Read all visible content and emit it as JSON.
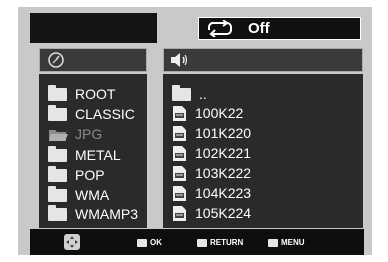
{
  "repeat": {
    "label": "Off",
    "icon": "repeat-icon"
  },
  "left_panel": {
    "header_icon": "clock-icon",
    "folders": [
      {
        "label": "ROOT",
        "icon": "folder-icon",
        "state": "normal"
      },
      {
        "label": "CLASSIC",
        "icon": "folder-icon",
        "state": "normal"
      },
      {
        "label": "JPG",
        "icon": "open-folder-icon",
        "state": "dim"
      },
      {
        "label": "METAL",
        "icon": "folder-icon",
        "state": "normal"
      },
      {
        "label": "POP",
        "icon": "folder-icon",
        "state": "normal"
      },
      {
        "label": "WMA",
        "icon": "folder-icon",
        "state": "normal"
      },
      {
        "label": "WMAMP3",
        "icon": "folder-icon",
        "state": "normal"
      }
    ]
  },
  "right_panel": {
    "header_icon": "speaker-icon",
    "items": [
      {
        "label": "..",
        "icon": "folder-icon"
      },
      {
        "label": "100K22",
        "icon": "file-icon"
      },
      {
        "label": "101K220",
        "icon": "file-icon"
      },
      {
        "label": "102K221",
        "icon": "file-icon"
      },
      {
        "label": "103K222",
        "icon": "file-icon"
      },
      {
        "label": "104K223",
        "icon": "file-icon"
      },
      {
        "label": "105K224",
        "icon": "file-icon"
      }
    ]
  },
  "footer": {
    "nav_icon": "dpad-icon",
    "ok_label": "OK",
    "return_label": "RETURN",
    "menu_label": "MENU"
  },
  "colors": {
    "frame": "#c9c9c9",
    "panel": "#2a2a2a",
    "bar": "#141414",
    "text": "#ffffff",
    "dim_text": "#8a8a8a"
  }
}
